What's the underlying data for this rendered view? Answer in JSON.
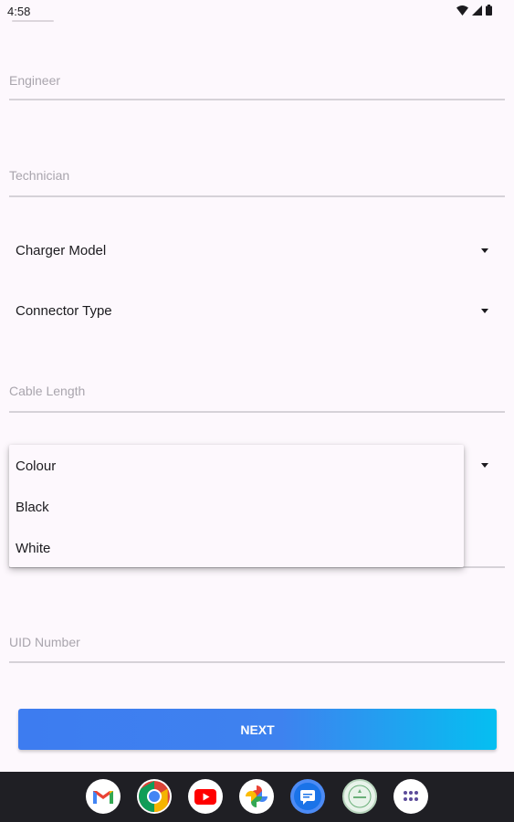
{
  "status_bar": {
    "time": "4:58"
  },
  "form": {
    "engineer_placeholder": "Engineer",
    "technician_placeholder": "Technician",
    "charger_model_label": "Charger Model",
    "connector_type_label": "Connector Type",
    "cable_length_placeholder": "Cable Length",
    "uid_number_placeholder": "UID Number"
  },
  "colour_menu": {
    "items": [
      "Colour",
      "Black",
      "White"
    ]
  },
  "next_button": {
    "label": "NEXT"
  },
  "taskbar": {
    "apps": [
      "gmail-icon",
      "chrome-icon",
      "youtube-icon",
      "photos-icon",
      "messages-icon",
      "app-icon",
      "app-drawer-icon"
    ],
    "accent_colors": {
      "button_start": "#3d7cf0",
      "button_end": "#05bff1"
    }
  }
}
